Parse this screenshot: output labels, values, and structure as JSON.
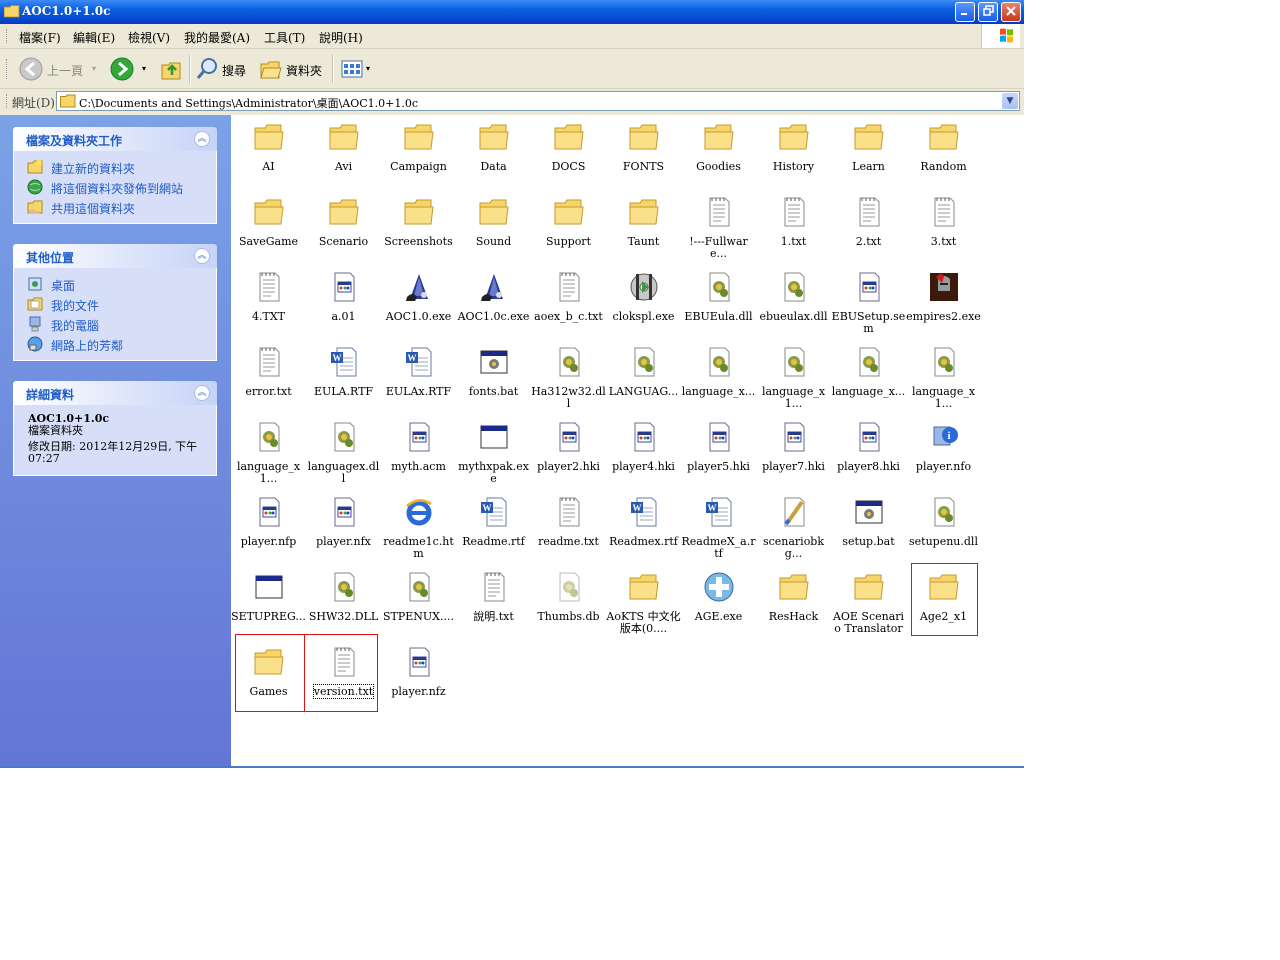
{
  "window": {
    "title": "AOC1.0+1.0c"
  },
  "menu": [
    "檔案(F)",
    "編輯(E)",
    "檢視(V)",
    "我的最愛(A)",
    "工具(T)",
    "說明(H)"
  ],
  "toolbar": {
    "back": "上一頁",
    "search": "搜尋",
    "folders": "資料夾"
  },
  "address": {
    "label": "網址(D)",
    "path": "C:\\Documents and Settings\\Administrator\\桌面\\AOC1.0+1.0c"
  },
  "tasks": {
    "title": "檔案及資料夾工作",
    "items": [
      "建立新的資料夾",
      "將這個資料夾發佈到網站",
      "共用這個資料夾"
    ]
  },
  "places": {
    "title": "其他位置",
    "items": [
      "桌面",
      "我的文件",
      "我的電腦",
      "網路上的芳鄰"
    ]
  },
  "details": {
    "title": "詳細資料",
    "name": "AOC1.0+1.0c",
    "type": "檔案資料夾",
    "modified": "修改日期: 2012年12月29日, 下午 07:27"
  },
  "files": [
    {
      "label": "AI",
      "icon": "folder"
    },
    {
      "label": "Avi",
      "icon": "folder"
    },
    {
      "label": "Campaign",
      "icon": "folder"
    },
    {
      "label": "Data",
      "icon": "folder"
    },
    {
      "label": "DOCS",
      "icon": "folder"
    },
    {
      "label": "FONTS",
      "icon": "folder"
    },
    {
      "label": "Goodies",
      "icon": "folder"
    },
    {
      "label": "History",
      "icon": "folder"
    },
    {
      "label": "Learn",
      "icon": "folder"
    },
    {
      "label": "Random",
      "icon": "folder"
    },
    {
      "label": "SaveGame",
      "icon": "folder"
    },
    {
      "label": "Scenario",
      "icon": "folder"
    },
    {
      "label": "Screenshots",
      "icon": "folder"
    },
    {
      "label": "Sound",
      "icon": "folder"
    },
    {
      "label": "Support",
      "icon": "folder"
    },
    {
      "label": "Taunt",
      "icon": "folder"
    },
    {
      "label": "!---Fullware...",
      "icon": "text"
    },
    {
      "label": "1.txt",
      "icon": "text"
    },
    {
      "label": "2.txt",
      "icon": "text"
    },
    {
      "label": "3.txt",
      "icon": "text"
    },
    {
      "label": "4.TXT",
      "icon": "text"
    },
    {
      "label": "a.01",
      "icon": "generic"
    },
    {
      "label": "AOC1.0.exe",
      "icon": "age-exe"
    },
    {
      "label": "AOC1.0c.exe",
      "icon": "age-exe"
    },
    {
      "label": "aoex_b_c.txt",
      "icon": "text"
    },
    {
      "label": "clokspl.exe",
      "icon": "disc-exe"
    },
    {
      "label": "EBUEula.dll",
      "icon": "dll"
    },
    {
      "label": "ebueulax.dll",
      "icon": "dll"
    },
    {
      "label": "EBUSetup.sem",
      "icon": "generic"
    },
    {
      "label": "empires2.exe",
      "icon": "helmet-exe"
    },
    {
      "label": "error.txt",
      "icon": "text"
    },
    {
      "label": "EULA.RTF",
      "icon": "word"
    },
    {
      "label": "EULAx.RTF",
      "icon": "word"
    },
    {
      "label": "fonts.bat",
      "icon": "batch"
    },
    {
      "label": "Ha312w32.dll",
      "icon": "dll"
    },
    {
      "label": "LANGUAG...",
      "icon": "dll"
    },
    {
      "label": "language_x...",
      "icon": "dll"
    },
    {
      "label": "language_x1...",
      "icon": "dll"
    },
    {
      "label": "language_x...",
      "icon": "dll"
    },
    {
      "label": "language_x1...",
      "icon": "dll"
    },
    {
      "label": "language_x1...",
      "icon": "dll"
    },
    {
      "label": "languagex.dll",
      "icon": "dll"
    },
    {
      "label": "myth.acm",
      "icon": "generic"
    },
    {
      "label": "mythxpak.exe",
      "icon": "window-exe"
    },
    {
      "label": "player2.hki",
      "icon": "generic"
    },
    {
      "label": "player4.hki",
      "icon": "generic"
    },
    {
      "label": "player5.hki",
      "icon": "generic"
    },
    {
      "label": "player7.hki",
      "icon": "generic"
    },
    {
      "label": "player8.hki",
      "icon": "generic"
    },
    {
      "label": "player.nfo",
      "icon": "info"
    },
    {
      "label": "player.nfp",
      "icon": "generic"
    },
    {
      "label": "player.nfx",
      "icon": "generic"
    },
    {
      "label": "readme1c.htm",
      "icon": "ie"
    },
    {
      "label": "Readme.rtf",
      "icon": "word"
    },
    {
      "label": "readme.txt",
      "icon": "text"
    },
    {
      "label": "Readmex.rtf",
      "icon": "word"
    },
    {
      "label": "ReadmeX_a.rtf",
      "icon": "word"
    },
    {
      "label": "scenariobkg...",
      "icon": "paint"
    },
    {
      "label": "setup.bat",
      "icon": "batch"
    },
    {
      "label": "setupenu.dll",
      "icon": "dll"
    },
    {
      "label": "SETUPREG...",
      "icon": "window-exe"
    },
    {
      "label": "SHW32.DLL",
      "icon": "dll"
    },
    {
      "label": "STPENUX....",
      "icon": "dll"
    },
    {
      "label": "說明.txt",
      "icon": "text"
    },
    {
      "label": "Thumbs.db",
      "icon": "dll-faded"
    },
    {
      "label": "AoKTS 中文化版本(0....",
      "icon": "folder"
    },
    {
      "label": "AGE.exe",
      "icon": "plus-exe"
    },
    {
      "label": "ResHack",
      "icon": "folder"
    },
    {
      "label": "AOE Scenario Translator",
      "icon": "folder"
    },
    {
      "label": "Age2_x1",
      "icon": "folder"
    },
    {
      "label": "Games",
      "icon": "folder"
    },
    {
      "label": "version.txt",
      "icon": "text"
    },
    {
      "label": "player.nfz",
      "icon": "generic"
    }
  ]
}
